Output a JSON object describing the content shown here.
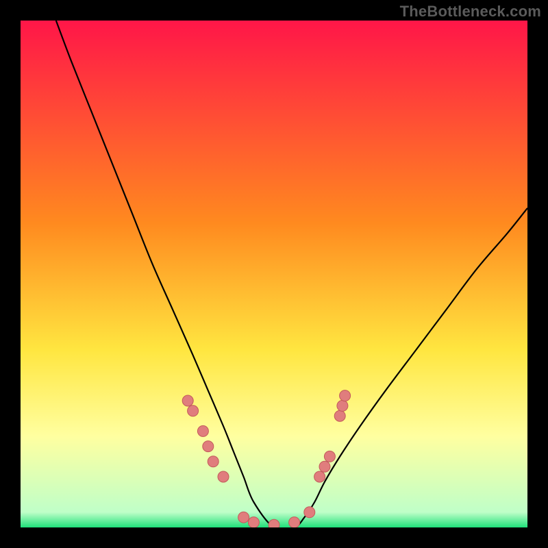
{
  "watermark": "TheBottleneck.com",
  "colors": {
    "top_red": "#ff1648",
    "mid_orange": "#ff8a1f",
    "mid_yellow": "#ffe640",
    "pale_yellow": "#ffffa0",
    "green": "#1fe07a",
    "curve": "#000000",
    "dot_fill": "#e07d7d",
    "dot_stroke": "#c25a5a",
    "frame": "#000000"
  },
  "chart_data": {
    "type": "line",
    "title": "",
    "xlabel": "",
    "ylabel": "",
    "xlim": [
      0,
      100
    ],
    "ylim": [
      0,
      100
    ],
    "grid": false,
    "legend": false,
    "series": [
      {
        "name": "bottleneck-curve",
        "x": [
          7,
          10,
          14,
          18,
          22,
          26,
          30,
          34,
          37,
          40,
          42,
          44,
          46,
          50,
          54,
          56,
          58,
          60,
          63,
          67,
          72,
          78,
          84,
          90,
          96,
          100
        ],
        "y": [
          100,
          92,
          82,
          72,
          62,
          52,
          43,
          34,
          27,
          20,
          15,
          10,
          5,
          0,
          0,
          2,
          5,
          9,
          14,
          20,
          27,
          35,
          43,
          51,
          58,
          63
        ]
      }
    ],
    "points": [
      {
        "x": 33,
        "y": 25
      },
      {
        "x": 34,
        "y": 23
      },
      {
        "x": 36,
        "y": 19
      },
      {
        "x": 37,
        "y": 16
      },
      {
        "x": 38,
        "y": 13
      },
      {
        "x": 40,
        "y": 10
      },
      {
        "x": 44,
        "y": 2
      },
      {
        "x": 46,
        "y": 1
      },
      {
        "x": 50,
        "y": 0.5
      },
      {
        "x": 54,
        "y": 1
      },
      {
        "x": 57,
        "y": 3
      },
      {
        "x": 59,
        "y": 10
      },
      {
        "x": 60,
        "y": 12
      },
      {
        "x": 61,
        "y": 14
      },
      {
        "x": 63,
        "y": 22
      },
      {
        "x": 63.5,
        "y": 24
      },
      {
        "x": 64,
        "y": 26
      }
    ]
  }
}
